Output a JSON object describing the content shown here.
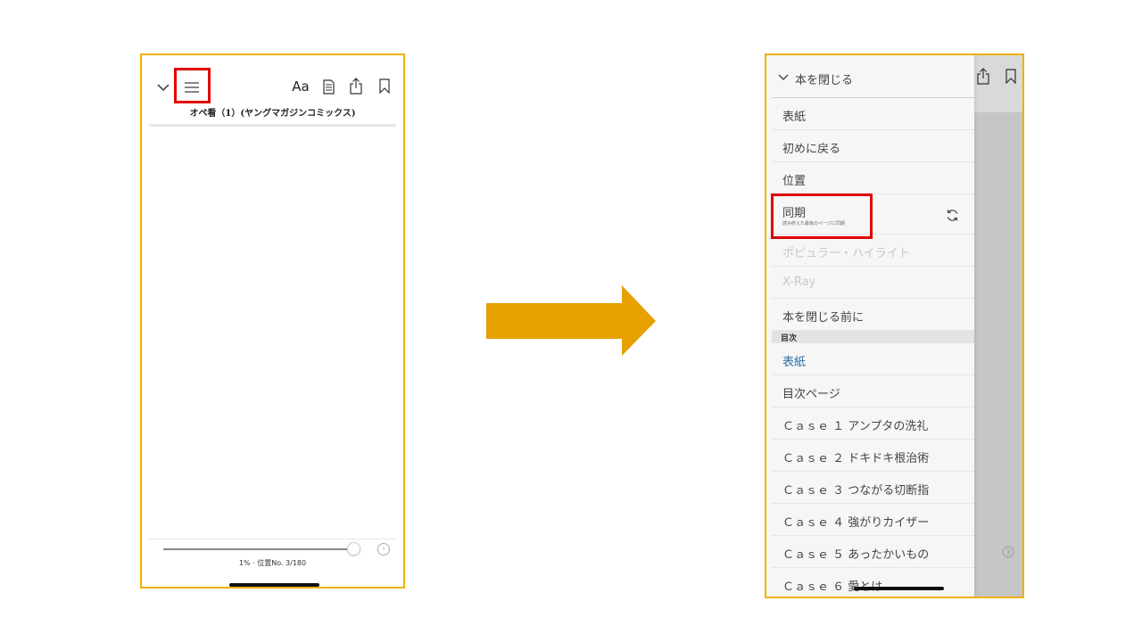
{
  "reader": {
    "book_title": "オペ看（1）(ヤングマガジンコミックス)",
    "progress_text": "1% · 位置No. 3/180",
    "progress_fraction": 0.02,
    "toolbar": {
      "font_label": "Aa",
      "icons": [
        "chevron-down-icon",
        "menu-icon",
        "document-icon",
        "share-icon",
        "bookmark-icon"
      ]
    }
  },
  "menu": {
    "close_label": "本を閉じる",
    "items": [
      {
        "label": "表紙"
      },
      {
        "label": "初めに戻る"
      },
      {
        "label": "位置"
      },
      {
        "label": "同期",
        "sublabel": "読み終えた最後のページに同期"
      },
      {
        "label": "ポピュラー・ハイライト"
      },
      {
        "label": "X-Ray"
      },
      {
        "label": "本を閉じる前に"
      }
    ],
    "toc_heading": "目次",
    "toc_items": [
      {
        "label": "表紙"
      },
      {
        "label": "目次ページ"
      },
      {
        "label": "Ｃａｓｅ １ アンプタの洗礼"
      },
      {
        "label": "Ｃａｓｅ ２ ドキドキ根治術"
      },
      {
        "label": "Ｃａｓｅ ３ つながる切断指"
      },
      {
        "label": "Ｃａｓｅ ４ 強がりカイザー"
      },
      {
        "label": "Ｃａｓｅ ５ あったかいもの"
      },
      {
        "label": "Ｃａｓｅ ６ 愛とは"
      }
    ]
  },
  "colors": {
    "frame": "#f0b000",
    "highlight": "#e00000",
    "arrow": "#e6a000",
    "link_blue": "#2e6fa8"
  }
}
